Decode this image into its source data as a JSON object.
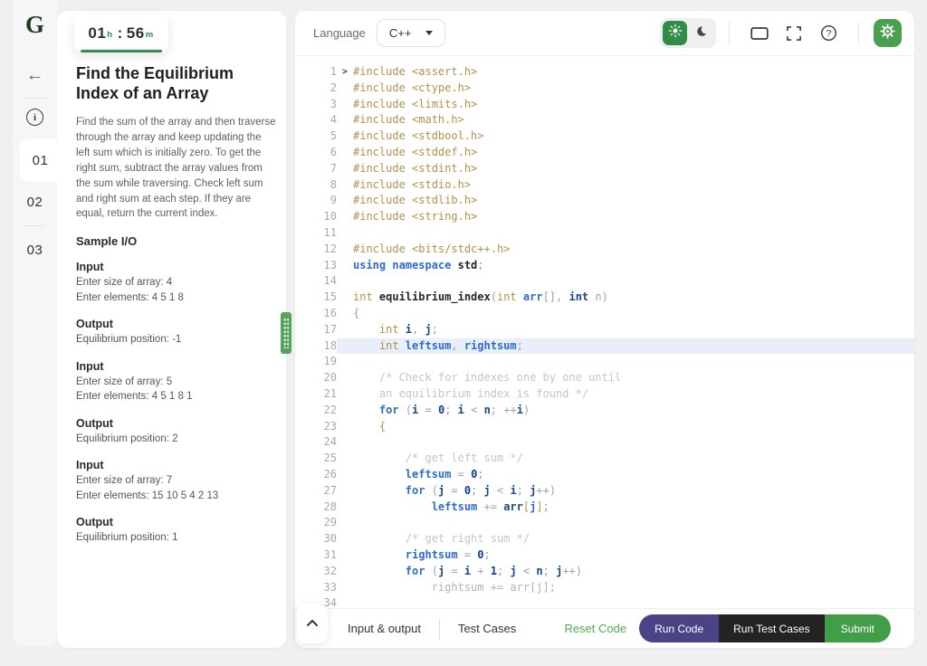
{
  "app": {
    "logo_letter": "G"
  },
  "sidebar": {
    "items": [
      {
        "label": "01",
        "active": true,
        "divider_before": false
      },
      {
        "label": "02",
        "active": false,
        "divider_before": false
      },
      {
        "label": "03",
        "active": false,
        "divider_before": true
      }
    ]
  },
  "timer": {
    "hours": "01",
    "hours_unit": "h",
    "separator": ":",
    "minutes": "56",
    "minutes_unit": "m"
  },
  "problem": {
    "title": "Find the Equilibrium Index of an Array",
    "description": "Find the sum of the array and then traverse through the array and keep updating the left sum which is initially zero. To get the right sum, subtract the array values from the sum while traversing. Check left sum and right sum at each step. If they are equal, return the current index.",
    "sample_heading": "Sample I/O",
    "samples": [
      {
        "label": "Input",
        "lines": [
          "Enter size of array: 4",
          "Enter elements: 4 5 1 8"
        ]
      },
      {
        "label": "Output",
        "lines": [
          "Equilibrium position: -1"
        ]
      },
      {
        "label": "Input",
        "lines": [
          "Enter size of array: 5",
          "Enter elements: 4 5 1 8 1"
        ]
      },
      {
        "label": "Output",
        "lines": [
          "Equilibrium position: 2"
        ]
      },
      {
        "label": "Input",
        "lines": [
          "Enter size of array: 7",
          "Enter elements: 15 10 5 4 2 13"
        ]
      },
      {
        "label": "Output",
        "lines": [
          "Equilibrium position: 1"
        ]
      }
    ]
  },
  "editor": {
    "language_label": "Language",
    "language_value": "C++",
    "code": {
      "fold_glyph": ">",
      "lines": [
        {
          "n": 1,
          "fold": true,
          "tk": [
            [
              "pp",
              "#include <assert.h>"
            ]
          ]
        },
        {
          "n": 2,
          "tk": [
            [
              "pp",
              "#include <ctype.h>"
            ]
          ]
        },
        {
          "n": 3,
          "tk": [
            [
              "pp",
              "#include <limits.h>"
            ]
          ]
        },
        {
          "n": 4,
          "tk": [
            [
              "pp",
              "#include <math.h>"
            ]
          ]
        },
        {
          "n": 5,
          "tk": [
            [
              "pp",
              "#include <stdbool.h>"
            ]
          ]
        },
        {
          "n": 6,
          "tk": [
            [
              "pp",
              "#include <stddef.h>"
            ]
          ]
        },
        {
          "n": 7,
          "tk": [
            [
              "pp",
              "#include <stdint.h>"
            ]
          ]
        },
        {
          "n": 8,
          "tk": [
            [
              "pp",
              "#include <stdio.h>"
            ]
          ]
        },
        {
          "n": 9,
          "tk": [
            [
              "pp",
              "#include <stdlib.h>"
            ]
          ]
        },
        {
          "n": 10,
          "tk": [
            [
              "pp",
              "#include <string.h>"
            ]
          ]
        },
        {
          "n": 11,
          "tk": []
        },
        {
          "n": 12,
          "tk": [
            [
              "pp",
              "#include <bits/stdc++.h>"
            ]
          ]
        },
        {
          "n": 13,
          "tk": [
            [
              "kw",
              "using namespace"
            ],
            [
              "df",
              " std"
            ],
            [
              "pn",
              ";"
            ]
          ]
        },
        {
          "n": 14,
          "tk": []
        },
        {
          "n": 15,
          "tk": [
            [
              "ty",
              "int"
            ],
            [
              "df",
              " equilibrium_index"
            ],
            [
              "pn",
              "("
            ],
            [
              "ty",
              "int"
            ],
            [
              "bl",
              " arr"
            ],
            [
              "pn",
              "[], "
            ],
            [
              "nv",
              "int"
            ],
            [
              "pn",
              " n)"
            ]
          ]
        },
        {
          "n": 16,
          "tk": [
            [
              "pn",
              "{"
            ]
          ]
        },
        {
          "n": 17,
          "tk": [
            [
              "ty",
              "    int "
            ],
            [
              "nv",
              "i"
            ],
            [
              "pn",
              ", "
            ],
            [
              "nv",
              "j"
            ],
            [
              "pn",
              ";"
            ]
          ]
        },
        {
          "n": 18,
          "hl": true,
          "tk": [
            [
              "ty",
              "    int "
            ],
            [
              "bl",
              "leftsum"
            ],
            [
              "pn",
              ", "
            ],
            [
              "bl",
              "rightsum"
            ],
            [
              "pn",
              ";"
            ]
          ]
        },
        {
          "n": 19,
          "tk": []
        },
        {
          "n": 20,
          "tk": [
            [
              "cm",
              "    /* Check for indexes one by one until"
            ]
          ]
        },
        {
          "n": 21,
          "tk": [
            [
              "cm",
              "    an equilibrium index is found */"
            ]
          ]
        },
        {
          "n": 22,
          "tk": [
            [
              "kw",
              "    for "
            ],
            [
              "pn",
              "("
            ],
            [
              "nv",
              "i"
            ],
            [
              "pn",
              " = "
            ],
            [
              "num",
              "0"
            ],
            [
              "pn",
              "; "
            ],
            [
              "nv",
              "i"
            ],
            [
              "pn",
              " < "
            ],
            [
              "nv",
              "n"
            ],
            [
              "pn",
              "; ++"
            ],
            [
              "nv",
              "i"
            ],
            [
              "pn",
              ")"
            ]
          ]
        },
        {
          "n": 23,
          "tk": [
            [
              "br",
              "    {"
            ]
          ]
        },
        {
          "n": 24,
          "tk": []
        },
        {
          "n": 25,
          "tk": [
            [
              "cm",
              "        /* get left sum */"
            ]
          ]
        },
        {
          "n": 26,
          "tk": [
            [
              "bl",
              "        leftsum"
            ],
            [
              "pn",
              " = "
            ],
            [
              "num",
              "0"
            ],
            [
              "pn",
              ";"
            ]
          ]
        },
        {
          "n": 27,
          "tk": [
            [
              "kw",
              "        for "
            ],
            [
              "pn",
              "("
            ],
            [
              "nv",
              "j"
            ],
            [
              "pn",
              " = "
            ],
            [
              "num",
              "0"
            ],
            [
              "pn",
              "; "
            ],
            [
              "nv",
              "j"
            ],
            [
              "pn",
              " < "
            ],
            [
              "nv",
              "i"
            ],
            [
              "pn",
              "; "
            ],
            [
              "nv",
              "j"
            ],
            [
              "pn",
              "++)"
            ]
          ]
        },
        {
          "n": 28,
          "tk": [
            [
              "bl",
              "            leftsum"
            ],
            [
              "pn",
              " += "
            ],
            [
              "nv",
              "arr"
            ],
            [
              "br",
              "["
            ],
            [
              "bl",
              "j"
            ],
            [
              "br",
              "]"
            ],
            [
              "pn",
              ";"
            ]
          ]
        },
        {
          "n": 29,
          "tk": []
        },
        {
          "n": 30,
          "tk": [
            [
              "cm",
              "        /* get right sum */"
            ]
          ]
        },
        {
          "n": 31,
          "tk": [
            [
              "bl",
              "        rightsum"
            ],
            [
              "pn",
              " = "
            ],
            [
              "num",
              "0"
            ],
            [
              "pn",
              ";"
            ]
          ]
        },
        {
          "n": 32,
          "tk": [
            [
              "kw",
              "        for "
            ],
            [
              "pn",
              "("
            ],
            [
              "nv",
              "j"
            ],
            [
              "pn",
              " = "
            ],
            [
              "nv",
              "i"
            ],
            [
              "pn",
              " + "
            ],
            [
              "num",
              "1"
            ],
            [
              "pn",
              "; "
            ],
            [
              "nv",
              "j"
            ],
            [
              "pn",
              " < "
            ],
            [
              "nv",
              "n"
            ],
            [
              "pn",
              "; "
            ],
            [
              "nv",
              "j"
            ],
            [
              "pn",
              "++)"
            ]
          ]
        },
        {
          "n": 33,
          "tk": [
            [
              "gr",
              "            rightsum += arr[j];"
            ]
          ]
        },
        {
          "n": 34,
          "tk": []
        }
      ]
    }
  },
  "footer": {
    "tab_io": "Input & output",
    "tab_testcases": "Test Cases",
    "reset_label": "Reset Code",
    "run_label": "Run Code",
    "run_tests_label": "Run Test Cases",
    "submit_label": "Submit"
  },
  "colors": {
    "brand_green": "#2f8d46",
    "gear_green": "#4aa04f",
    "submit_green": "#3f9e46",
    "reset_green": "#4cae50",
    "run_purple": "#4a4486",
    "run_tests_black": "#232323",
    "highlight_line_bg": "#e9effa"
  }
}
